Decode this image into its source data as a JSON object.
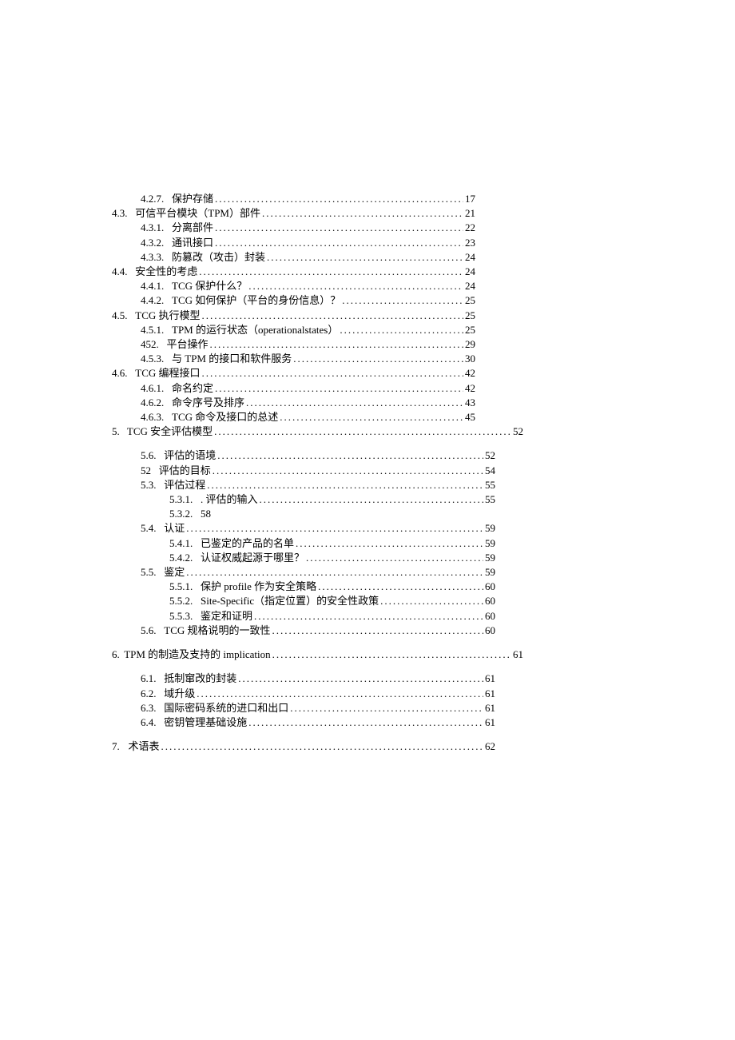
{
  "toc": [
    {
      "indent": 2,
      "num": "4.2.7.",
      "title": "保护存储",
      "page": "17",
      "w": "wrap-right"
    },
    {
      "indent": 1,
      "num": "4.3.",
      "title": "可信平台模块（TPM）部件 ",
      "page": "21",
      "w": "wrap-right"
    },
    {
      "indent": 2,
      "num": "4.3.1.",
      "title": "分离部件",
      "page": "22",
      "w": "wrap-right"
    },
    {
      "indent": 2,
      "num": "4.3.2.",
      "title": "通讯接口",
      "page": "23",
      "w": "wrap-right"
    },
    {
      "indent": 2,
      "num": "4.3.3.",
      "title": "防篡改（攻击）封装",
      "page": "24",
      "w": "wrap-right"
    },
    {
      "indent": 1,
      "num": "4.4.",
      "title": "安全性的考虑",
      "page": "24",
      "w": "wrap-right"
    },
    {
      "indent": 2,
      "num": "4.4.1.",
      "title": "TCG 保护什么？ ",
      "page": "24",
      "w": "wrap-right"
    },
    {
      "indent": 2,
      "num": "4.4.2.",
      "title": "TCG 如何保护（平台的身份信息）？ ",
      "page": "25",
      "w": "wrap-right"
    },
    {
      "indent": 1,
      "num": "4.5.",
      "title": "TCG 执行模型 ",
      "page": "25",
      "w": "wrap-right"
    },
    {
      "indent": 2,
      "num": "4.5.1.",
      "title": "TPM 的运行状态（operationalstates） ",
      "page": "25",
      "w": "wrap-right"
    },
    {
      "indent": 2,
      "num": "452.",
      "title": " 平台操作",
      "page": "29",
      "w": "wrap-right"
    },
    {
      "indent": 2,
      "num": "4.5.3.",
      "title": "与 TPM 的接口和软件服务  ",
      "page": "30",
      "w": "wrap-right"
    },
    {
      "indent": 1,
      "num": "4.6.",
      "title": "TCG 编程接口 ",
      "page": "42",
      "w": "wrap-right"
    },
    {
      "indent": 2,
      "num": "4.6.1.",
      "title": "命名约定",
      "page": "42",
      "w": "wrap-right"
    },
    {
      "indent": 2,
      "num": "4.6.2.",
      "title": "命令序号及排序",
      "page": "43",
      "w": "wrap-right"
    },
    {
      "indent": 2,
      "num": "4.6.3.",
      "title": "TCG 命令及接口的总述",
      "page": "45",
      "w": "wrap-right"
    },
    {
      "indent": 0,
      "num": "5.",
      "title": "TCG 安全评估模型 ",
      "page": "52",
      "w": "wrap-right3",
      "gap_after": true
    },
    {
      "indent": 2,
      "num": "5.6.",
      "title": "评估的语境",
      "page": "52",
      "w": "wrap-right2"
    },
    {
      "indent": 2,
      "num": "52",
      "title": " 评估的目标 ",
      "page": "54",
      "w": "wrap-right2"
    },
    {
      "indent": 2,
      "num": "5.3.",
      "title": "评估过程",
      "page": "55",
      "w": "wrap-right2"
    },
    {
      "indent": 3,
      "num": "5.3.1.",
      "title": ". 评估的输入 ",
      "page": "55",
      "w": "wrap-right2"
    },
    {
      "indent": 3,
      "num": "5.3.2.",
      "title": "58",
      "page": "",
      "w": "wrap-right2",
      "nodots": true
    },
    {
      "indent": 2,
      "num": "5.4.",
      "title": "认证",
      "page": "59",
      "w": "wrap-right2"
    },
    {
      "indent": 3,
      "num": "5.4.1.",
      "title": "已鉴定的产品的名单 ",
      "page": "59",
      "w": "wrap-right2"
    },
    {
      "indent": 3,
      "num": "5.4.2.",
      "title": "认证权威起源于哪里？ ",
      "page": "59",
      "w": "wrap-right2"
    },
    {
      "indent": 2,
      "num": "5.5.",
      "title": "鉴定",
      "page": "59",
      "w": "wrap-right2"
    },
    {
      "indent": 3,
      "num": "5.5.1.",
      "title": "保护 profile 作为安全策略 ",
      "page": "60",
      "w": "wrap-right2"
    },
    {
      "indent": 3,
      "num": "5.5.2.",
      "title": "Site-Specific（指定位置）的安全性政策 ",
      "page": "60",
      "w": "wrap-right2"
    },
    {
      "indent": 3,
      "num": "5.5.3.",
      "title": "鉴定和证明 ",
      "page": "60",
      "w": "wrap-right2"
    },
    {
      "indent": 2,
      "num": "5.6.",
      "title": "TCG 规格说明的一致性 ",
      "page": "60",
      "w": "wrap-right2",
      "gap_after": true
    },
    {
      "indent": 0,
      "num": "6.",
      "title": "TPM 的制造及支持的 implication ",
      "page": "61",
      "w": "wrap-right3",
      "gap_after": true
    },
    {
      "indent": 2,
      "num": "6.1.",
      "title": "抵制窜改的封装",
      "page": "61",
      "w": "wrap-right2"
    },
    {
      "indent": 2,
      "num": "6.2.",
      "title": "域升级",
      "page": "61",
      "w": "wrap-right2"
    },
    {
      "indent": 2,
      "num": "6.3.",
      "title": "国际密码系统的进口和出口 ",
      "page": "61",
      "w": "wrap-right2"
    },
    {
      "indent": 2,
      "num": "6.4.",
      "title": "密钥管理基础设施 ",
      "page": "61",
      "w": "wrap-right2",
      "gap_after": true
    },
    {
      "indent": 0,
      "num": "7.",
      "title": "术语表",
      "page": "62",
      "w": "wrap-right2"
    }
  ]
}
